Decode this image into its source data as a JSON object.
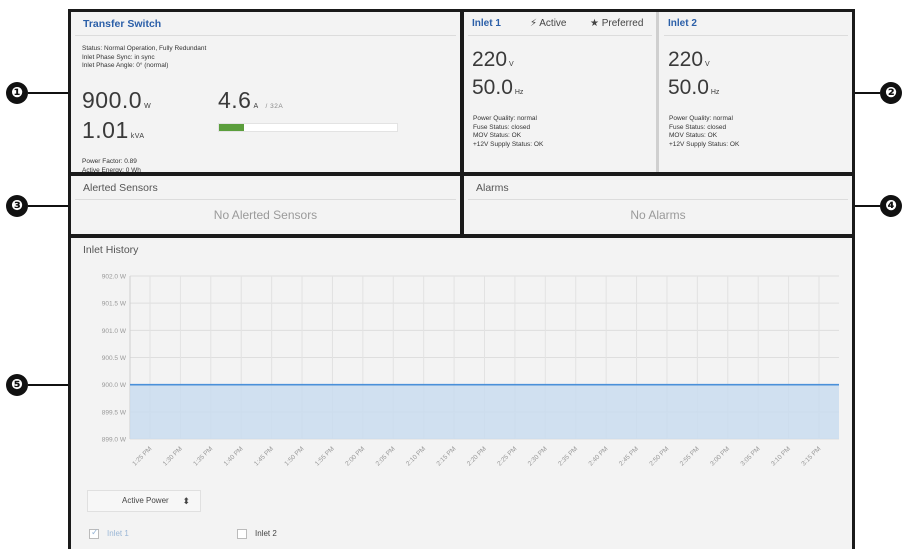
{
  "callouts": [
    "❶",
    "❷",
    "❸",
    "❹",
    "❺"
  ],
  "transfer_switch": {
    "title": "Transfer Switch",
    "status_lines": [
      "Status: Normal Operation, Fully Redundant",
      "Inlet Phase Sync: in sync",
      "Inlet Phase Angle: 0° (normal)"
    ],
    "power_value": "900.0",
    "power_unit": "W",
    "apparent_value": "1.01",
    "apparent_unit": "kVA",
    "current_value": "4.6",
    "current_unit": "A",
    "current_max": "/ 32A",
    "current_fraction": 0.14,
    "power_factor": "Power Factor: 0.89",
    "active_energy": "Active Energy: 0 Wh",
    "bar_color": "#5b9e3c"
  },
  "inlet1": {
    "name": "Inlet 1",
    "active_label": "Active",
    "preferred_label": "Preferred",
    "voltage": "220",
    "voltage_unit": "V",
    "frequency": "50.0",
    "frequency_unit": "Hz",
    "status_lines": [
      "Power Quality: normal",
      "Fuse Status: closed",
      "MOV Status: OK",
      "+12V Supply Status: OK"
    ]
  },
  "inlet2": {
    "name": "Inlet 2",
    "voltage": "220",
    "voltage_unit": "V",
    "frequency": "50.0",
    "frequency_unit": "Hz",
    "status_lines": [
      "Power Quality: normal",
      "Fuse Status: closed",
      "MOV Status: OK",
      "+12V Supply Status: OK"
    ]
  },
  "alerted_sensors": {
    "title": "Alerted Sensors",
    "empty": "No Alerted Sensors"
  },
  "alarms": {
    "title": "Alarms",
    "empty": "No Alarms"
  },
  "history": {
    "title": "Inlet History",
    "select_value": "Active Power",
    "select_arrow": "⬍",
    "checkbox_inlet1": "Inlet 1",
    "checkbox_inlet2": "Inlet 2",
    "inlet1_checked": true,
    "inlet2_checked": false
  },
  "chart_data": {
    "type": "area",
    "ylabel": "",
    "ylim": [
      899.0,
      902.0
    ],
    "yticks": [
      "902.0 W",
      "901.5 W",
      "901.0 W",
      "900.5 W",
      "900.0 W",
      "899.5 W",
      "899.0 W"
    ],
    "ytick_values": [
      902.0,
      901.5,
      901.0,
      900.5,
      900.0,
      899.5,
      899.0
    ],
    "x": [
      "1:25 PM",
      "1:30 PM",
      "1:35 PM",
      "1:40 PM",
      "1:45 PM",
      "1:50 PM",
      "1:55 PM",
      "2:00 PM",
      "2:05 PM",
      "2:10 PM",
      "2:15 PM",
      "2:20 PM",
      "2:25 PM",
      "2:30 PM",
      "2:35 PM",
      "2:40 PM",
      "2:45 PM",
      "2:50 PM",
      "2:55 PM",
      "3:00 PM",
      "3:05 PM",
      "3:10 PM",
      "3:15 PM"
    ],
    "series": [
      {
        "values": [
          900.0,
          900.0,
          900.0,
          900.0,
          900.0,
          900.0,
          900.0,
          900.0,
          900.0,
          900.0,
          900.0,
          900.0,
          900.0,
          900.0,
          900.0,
          900.0,
          900.0,
          900.0,
          900.0,
          900.0,
          900.0,
          900.0,
          900.0
        ],
        "color": "#4a90d9",
        "fill": "#c9dcef"
      }
    ],
    "grid": true,
    "legend": "none"
  }
}
